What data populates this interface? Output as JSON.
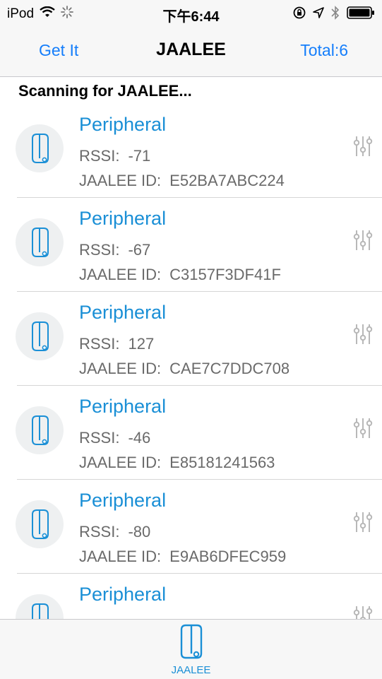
{
  "status_bar": {
    "carrier": "iPod",
    "time": "下午6:44"
  },
  "nav": {
    "left_button": "Get It",
    "title": "JAALEE",
    "right_button": "Total:6"
  },
  "scanning_text": "Scanning for JAALEE...",
  "rssi_label": "RSSI:",
  "id_label": "JAALEE ID:",
  "devices": [
    {
      "name": "Peripheral",
      "rssi": "-71",
      "id": "E52BA7ABC224"
    },
    {
      "name": "Peripheral",
      "rssi": "-67",
      "id": "C3157F3DF41F"
    },
    {
      "name": "Peripheral",
      "rssi": "127",
      "id": "CAE7C7DDC708"
    },
    {
      "name": "Peripheral",
      "rssi": "-46",
      "id": "E85181241563"
    },
    {
      "name": "Peripheral",
      "rssi": "-80",
      "id": "E9AB6DFEC959"
    },
    {
      "name": "Peripheral"
    }
  ],
  "tab_bar": {
    "label": "JAALEE",
    "icon": "tag-icon"
  },
  "icons": [
    "wifi-icon",
    "loading-spinner-icon",
    "lock-rotation-icon",
    "location-icon",
    "bluetooth-icon",
    "battery-icon",
    "tag-icon",
    "sliders-icon"
  ],
  "colors": {
    "accent": "#157efb",
    "title_blue": "#1a8fd6",
    "secondary_text": "#6a6a6a",
    "bar_bg": "#f7f7f7"
  }
}
